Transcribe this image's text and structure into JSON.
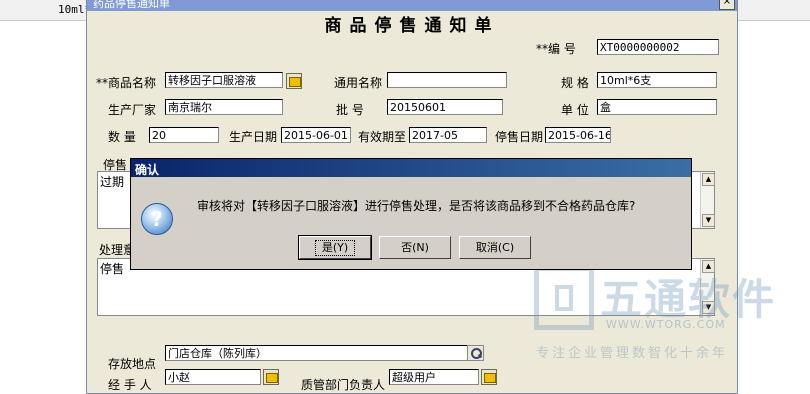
{
  "background": {
    "size_cell": "10ml*"
  },
  "window": {
    "title": "药品停售通知单",
    "close_symbol": "×"
  },
  "form": {
    "title": "商品停售通知单",
    "number_label": "**编    号",
    "number_value": "XT0000000002",
    "product_name_label": "**商品名称",
    "product_name_value": "转移因子口服溶液",
    "generic_name_label": "通用名称",
    "generic_name_value": "",
    "spec_label": "规    格",
    "spec_value": "10ml*6支",
    "manufacturer_label": "生产厂家",
    "manufacturer_value": "南京瑞尔",
    "batch_label": "批    号",
    "batch_value": "20150601",
    "unit_label": "单    位",
    "unit_value": "盒",
    "quantity_label": "数    量",
    "quantity_value": "20",
    "production_date_label": "生产日期",
    "production_date_value": "2015-06-01",
    "expiry_label": "有效期至",
    "expiry_value": "2017-05",
    "stop_date_label": "停售日期",
    "stop_date_value": "2015-06-16",
    "stop_reason_label": "停售",
    "stop_reason_value": "过期",
    "handling_label": "处理意",
    "handling_value": "停售",
    "storage_label": "存放地点",
    "storage_value": "门店仓库（陈列库）",
    "handler_label": "经 手 人",
    "handler_value": "小赵",
    "quality_label": "质管部门负责人",
    "quality_value": "超级用户"
  },
  "dialog": {
    "title": "确认",
    "icon": "question-icon",
    "message": "审核将对【转移因子口服溶液】进行停售处理，是否将该商品移到不合格药品仓库?",
    "yes_label": "是(Y)",
    "no_label": "否(N)",
    "cancel_label": "取消(C)"
  },
  "watermark": {
    "brand": "五通软件",
    "url": "WWW.WTORG.COM",
    "tagline": "专注企业管理数智化十余年"
  }
}
